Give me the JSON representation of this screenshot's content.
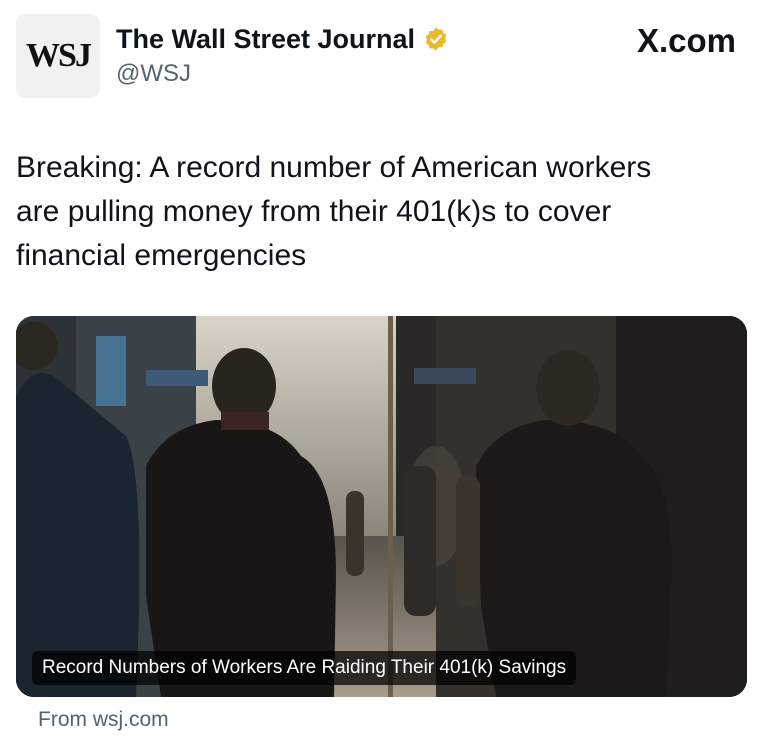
{
  "account": {
    "avatar_text": "WSJ",
    "name": "The Wall Street Journal",
    "handle": "@WSJ",
    "verified_icon": "gold-verified-badge",
    "verified_color": "#E8B82F"
  },
  "site_logo": "X.com",
  "tweet": {
    "text_lines": [
      "Breaking: A record number of American workers",
      "are pulling money from their 401(k)s to cover",
      "financial emergencies"
    ]
  },
  "link_card": {
    "image_description_icon": "street-photo",
    "headline": "Record Numbers of Workers Are Raiding Their 401(k) Savings",
    "source": "From wsj.com"
  }
}
